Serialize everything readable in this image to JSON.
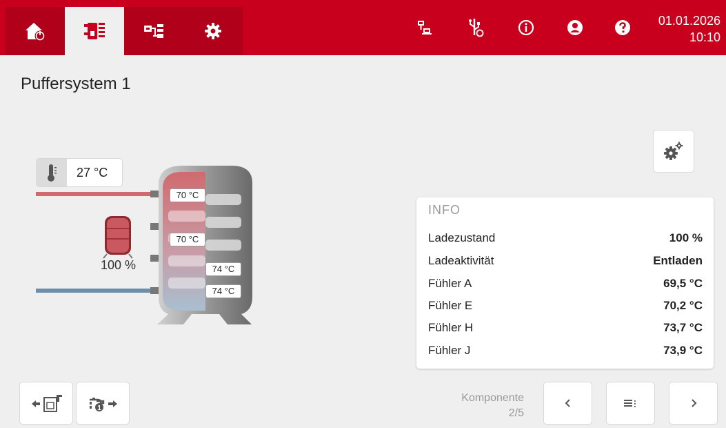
{
  "header": {
    "date": "01.01.2026",
    "time": "10:10",
    "tabs": [
      {
        "icon": "home-power-icon",
        "active": false
      },
      {
        "icon": "buffer-tank-icon",
        "active": true
      },
      {
        "icon": "system-components-icon",
        "active": false
      },
      {
        "icon": "settings-gear-icon",
        "active": false
      }
    ],
    "toolbar_icons": [
      "network-icon",
      "usb-icon",
      "info-icon",
      "user-icon",
      "help-icon"
    ]
  },
  "page": {
    "title": "Puffersystem 1"
  },
  "outdoor": {
    "temperature": "27 °C"
  },
  "tank": {
    "charge_label": "100 %",
    "charge_fraction": 1.0,
    "sensors": [
      "70 °C",
      "70 °C",
      "74 °C",
      "74 °C"
    ]
  },
  "info": {
    "heading": "INFO",
    "rows": [
      {
        "label": "Ladezustand",
        "value": "100 %"
      },
      {
        "label": "Ladeaktivität",
        "value": "Entladen"
      },
      {
        "label": "Fühler A",
        "value": "69,5 °C"
      },
      {
        "label": "Fühler E",
        "value": "70,2 °C"
      },
      {
        "label": "Fühler H",
        "value": "73,7 °C"
      },
      {
        "label": "Fühler J",
        "value": "73,9 °C"
      }
    ]
  },
  "footer": {
    "component_label": "Komponente",
    "component_index": "2/5"
  },
  "colors": {
    "brand": "#c8001e",
    "hot": "#d06a6e",
    "cold": "#6f8fa8"
  }
}
